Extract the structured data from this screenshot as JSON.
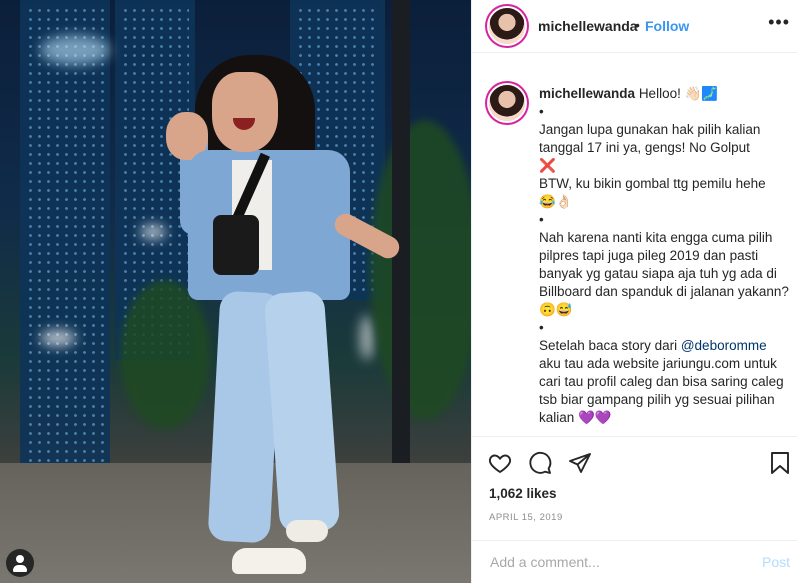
{
  "post": {
    "username": "michellewanda",
    "follow_label": "Follow",
    "more_label": "•••",
    "header_separator": "•"
  },
  "caption": {
    "username": "michellewanda",
    "intro": "Helloo! 👋🏻🗾",
    "bullet": "•",
    "line1": "Jangan lupa gunakan hak pilih kalian tanggal 17 ini ya, gengs! No Golput",
    "line1_emoji": "❌",
    "line2": "BTW, ku bikin gombal ttg pemilu hehe",
    "line2_emoji": "😂👌🏻",
    "line3": "Nah karena nanti kita engga cuma pilih pilpres tapi juga pileg 2019 dan pasti banyak yg gatau siapa aja tuh yg ada di Billboard dan spanduk di jalanan yakann?",
    "line3_emoji": "🙃😅",
    "line4_before": "Setelah baca story dari ",
    "line4_mention": "@deboromme",
    "line4_after": " aku tau ada website jariungu.com untuk cari tau profil caleg dan bisa saring caleg tsb biar gampang pilih yg sesuai pilihan kalian",
    "line4_emoji": "💜💜"
  },
  "engagement": {
    "likes": "1,062 likes",
    "date": "APRIL 15, 2019"
  },
  "comment": {
    "placeholder": "Add a comment...",
    "post_label": "Post"
  },
  "icons": {
    "like": "heart-icon",
    "comment": "comment-icon",
    "share": "share-icon",
    "save": "bookmark-icon",
    "user_tag": "user-icon"
  },
  "colors": {
    "follow": "#3897f0",
    "post_disabled": "#b3dbff",
    "muted": "#8e8e8e",
    "mention": "#003569"
  }
}
